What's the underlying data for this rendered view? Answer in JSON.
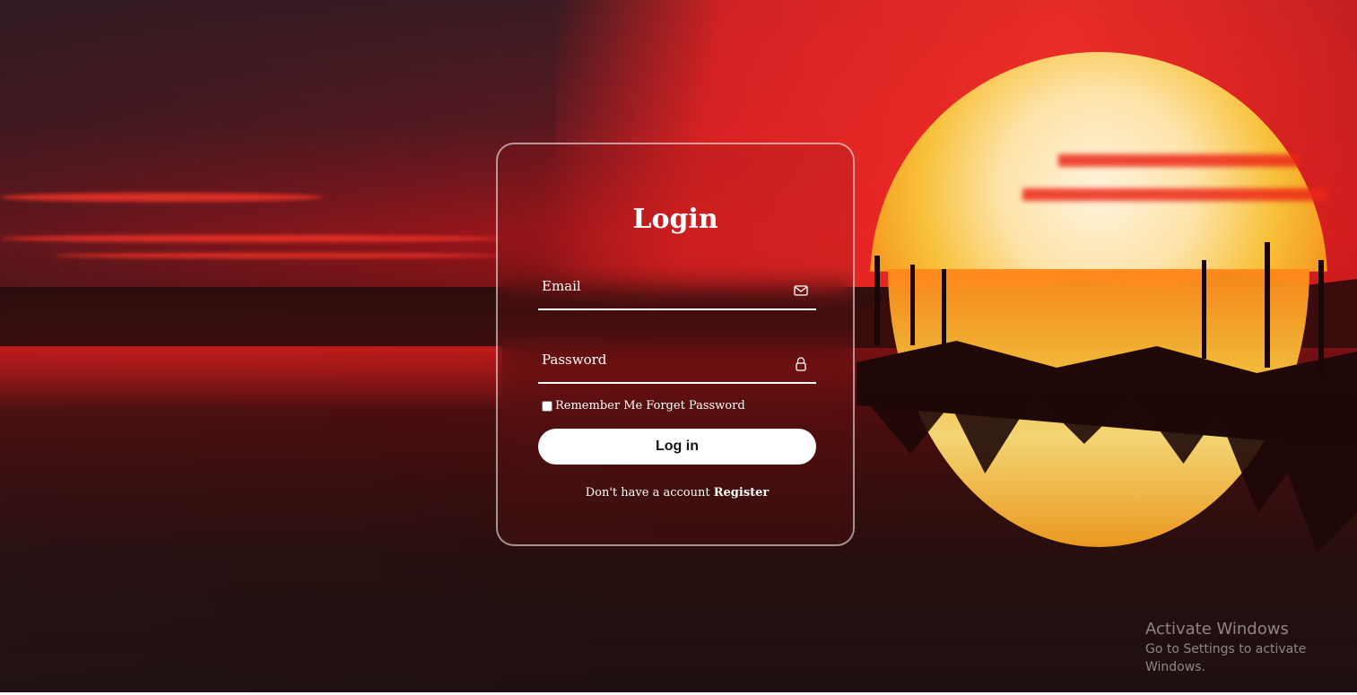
{
  "background": {
    "description_icons": [
      "sunset-background"
    ]
  },
  "login": {
    "title": "Login",
    "email_placeholder": "Email",
    "email_icon": "mail-icon",
    "password_placeholder": "Password",
    "password_icon": "lock-icon",
    "remember_label": "Remember Me",
    "forget_label": "Forget Password",
    "button_label": "Log in",
    "register_prompt": "Don't have a account",
    "register_link": "Register"
  },
  "watermark": {
    "title": "Activate Windows",
    "subtitle": "Go to Settings to activate Windows."
  },
  "colors": {
    "accent": "#ffffff",
    "border": "rgba(255,255,255,0.55)"
  }
}
